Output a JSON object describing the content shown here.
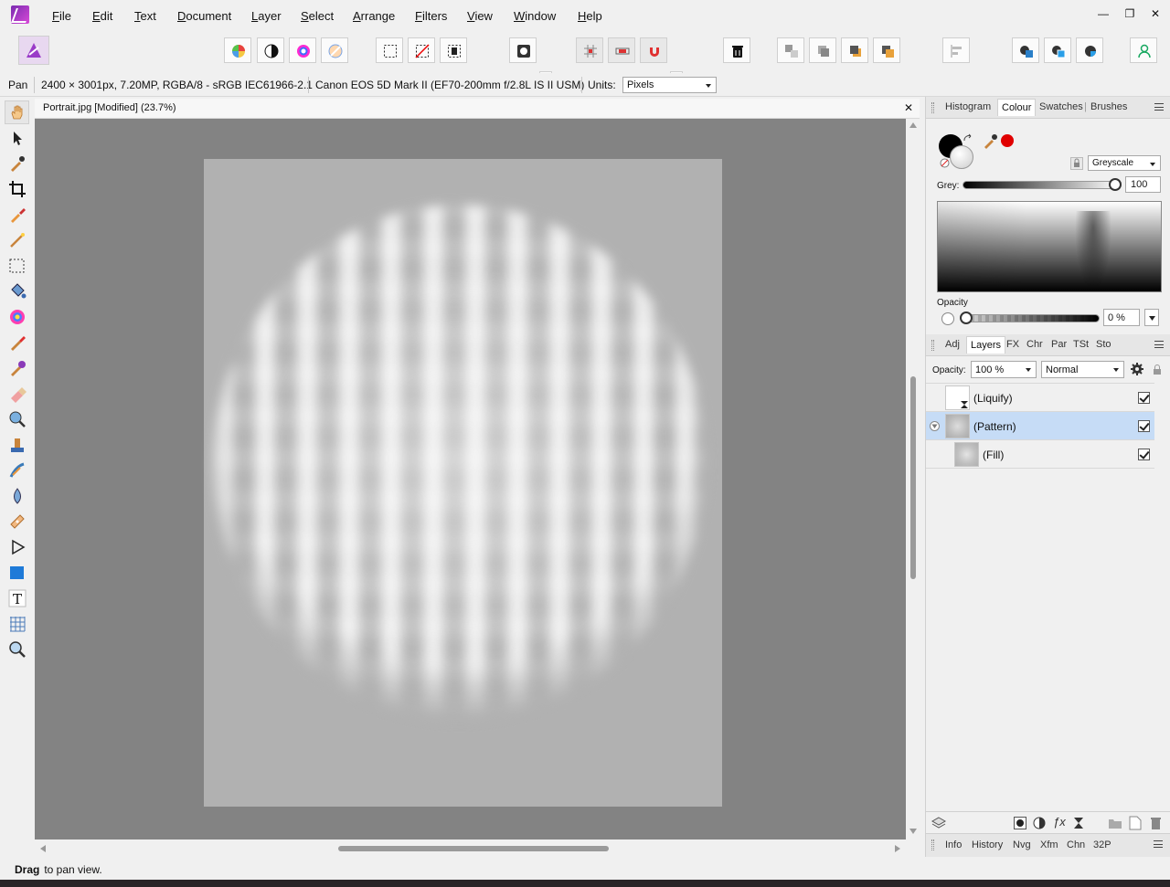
{
  "menu": [
    "File",
    "Edit",
    "Text",
    "Document",
    "Layer",
    "Select",
    "Arrange",
    "Filters",
    "View",
    "Window",
    "Help"
  ],
  "window_controls": {
    "minimize": "—",
    "restore": "❐",
    "close": "✕"
  },
  "context": {
    "tool": "Pan",
    "image_info": "2400 × 3001px, 7.20MP, RGBA/8 - sRGB IEC61966-2.1",
    "camera_info": "Canon EOS 5D Mark II (EF70-200mm f/2.8L IS II USM)",
    "units_label": "Units:",
    "units_value": "Pixels"
  },
  "document": {
    "tab_title": "Portrait.jpg [Modified] (23.7%)",
    "close": "✕"
  },
  "panel_top": {
    "tabs": [
      "Histogram",
      "Colour",
      "Swatches",
      "Brushes"
    ],
    "active_tab": "Colour",
    "mode": "Greyscale",
    "grey_label": "Grey:",
    "grey_value": "100",
    "opacity_label": "Opacity",
    "opacity_value": "0 %"
  },
  "panel_layers": {
    "tabs": [
      "Adj",
      "Layers",
      "FX",
      "Chr",
      "Par",
      "TSt",
      "Sto"
    ],
    "active_tab": "Layers",
    "opacity_label": "Opacity:",
    "opacity_value": "100 %",
    "blend_mode": "Normal",
    "layers": [
      {
        "name": "(Liquify)",
        "visible": true,
        "selected": false
      },
      {
        "name": "(Pattern)",
        "visible": true,
        "selected": true
      },
      {
        "name": "(Fill)",
        "visible": true,
        "selected": false
      }
    ]
  },
  "panel_bottom": {
    "tabs": [
      "Info",
      "History",
      "Nvg",
      "Xfm",
      "Chn",
      "32P"
    ]
  },
  "status": {
    "bold": "Drag",
    "rest": " to pan view."
  },
  "colors": {
    "accent_purple": "#8a2bb8",
    "selection_blue": "#c6dcf6",
    "canvas_grey": "#838383",
    "page_grey": "#b1b1b1",
    "primary_red": "#e00000"
  }
}
